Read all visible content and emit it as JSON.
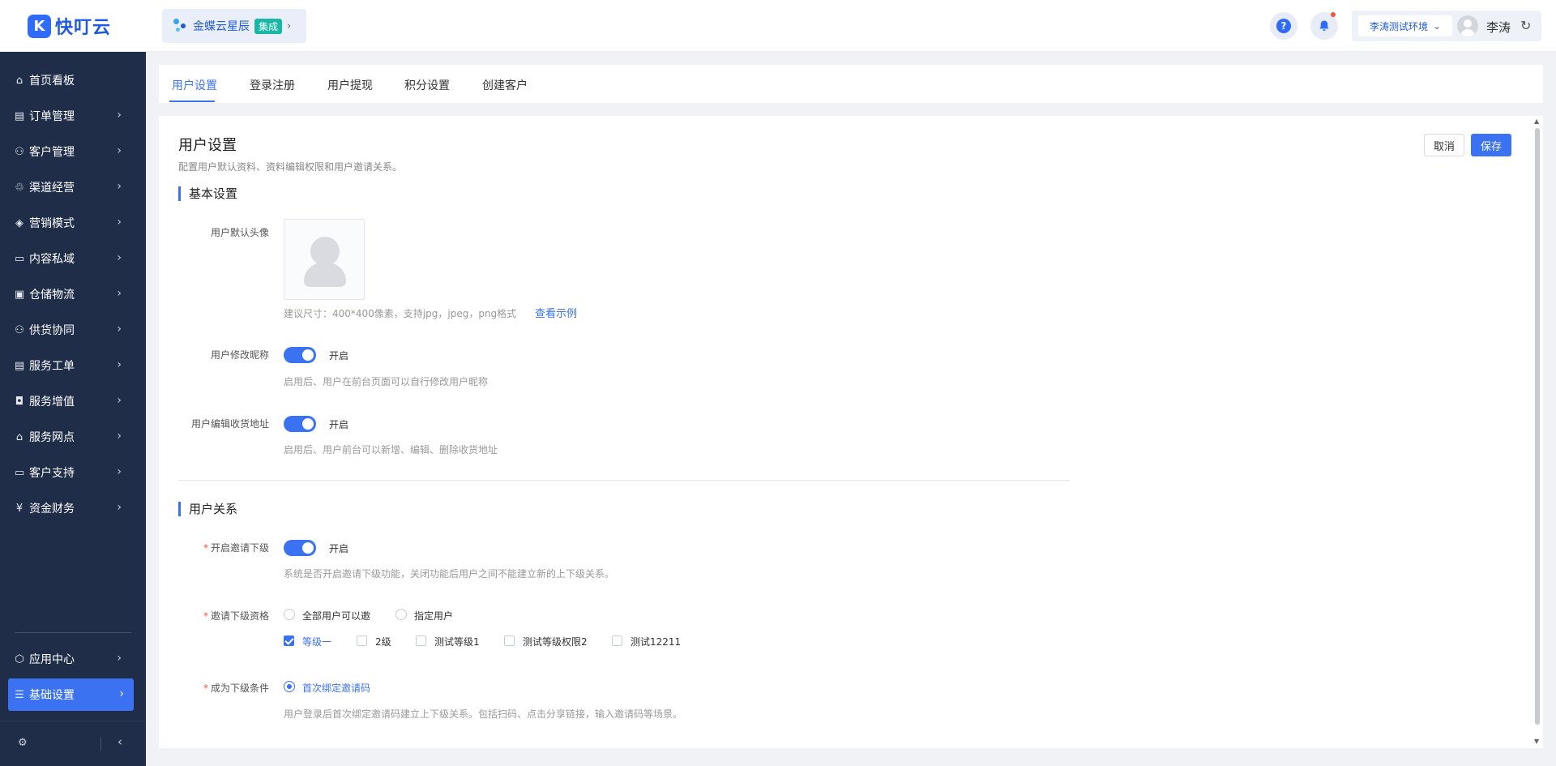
{
  "header": {
    "logo_glyph": "K",
    "logo_text": "快叮云",
    "org_name": "金蝶云星辰",
    "org_badge": "集成",
    "help_glyph": "?",
    "env_label": "李涛测试环境",
    "user_name": "李涛"
  },
  "sidebar": {
    "items": [
      {
        "label": "首页看板",
        "icon": "home-icon"
      },
      {
        "label": "订单管理",
        "icon": "order-icon"
      },
      {
        "label": "客户管理",
        "icon": "user-icon"
      },
      {
        "label": "渠道经营",
        "icon": "channel-icon"
      },
      {
        "label": "营销模式",
        "icon": "tag-icon"
      },
      {
        "label": "内容私域",
        "icon": "image-icon"
      },
      {
        "label": "仓储物流",
        "icon": "warehouse-icon"
      },
      {
        "label": "供货协同",
        "icon": "supply-icon"
      },
      {
        "label": "服务工单",
        "icon": "ticket-icon"
      },
      {
        "label": "服务增值",
        "icon": "bag-icon"
      },
      {
        "label": "服务网点",
        "icon": "store-icon"
      },
      {
        "label": "客户支持",
        "icon": "support-icon"
      },
      {
        "label": "资金财务",
        "icon": "yen-icon"
      }
    ],
    "bottom_items": [
      {
        "label": "应用中心",
        "icon": "app-icon"
      },
      {
        "label": "基础设置",
        "icon": "settings-icon",
        "active": true
      }
    ]
  },
  "tabs": [
    "用户设置",
    "登录注册",
    "用户提现",
    "积分设置",
    "创建客户"
  ],
  "active_tab": 0,
  "page": {
    "title": "用户设置",
    "description": "配置用户默认资料、资料编辑权限和用户邀请关系。",
    "cancel_label": "取消",
    "save_label": "保存"
  },
  "basic": {
    "section_title": "基本设置",
    "avatar_label": "用户默认头像",
    "avatar_hint": "建议尺寸：400*400像素，支持jpg，jpeg，png格式",
    "avatar_link": "查看示例",
    "nickname_label": "用户修改昵称",
    "nickname_state": "开启",
    "nickname_hint": "启用后、用户在前台页面可以自行修改用户昵称",
    "address_label": "用户编辑收货地址",
    "address_state": "开启",
    "address_hint": "启用后、用户前台可以新增、编辑、删除收货地址"
  },
  "relation": {
    "section_title": "用户关系",
    "invite_label": "开启邀请下级",
    "invite_state": "开启",
    "invite_hint": "系统是否开启邀请下级功能，关闭功能后用户之间不能建立新的上下级关系。",
    "qualify_label": "邀请下级资格",
    "qualify_options": [
      "全部用户可以邀",
      "指定用户"
    ],
    "levels": [
      {
        "label": "等级一",
        "checked": true
      },
      {
        "label": "2级",
        "checked": false
      },
      {
        "label": "测试等级1",
        "checked": false
      },
      {
        "label": "测试等级权限2",
        "checked": false
      },
      {
        "label": "测试12211",
        "checked": false
      }
    ],
    "condition_label": "成为下级条件",
    "condition_option": "首次绑定邀请码",
    "condition_hint": "用户登录后首次绑定邀请码建立上下级关系。包括扫码、点击分享链接，输入邀请码等场景。"
  },
  "required_mark": "*",
  "colors": {
    "primary": "#3b72f2",
    "sidebar_bg": "#1f2d49",
    "badge": "#19b7a6",
    "danger": "#f5503a"
  }
}
